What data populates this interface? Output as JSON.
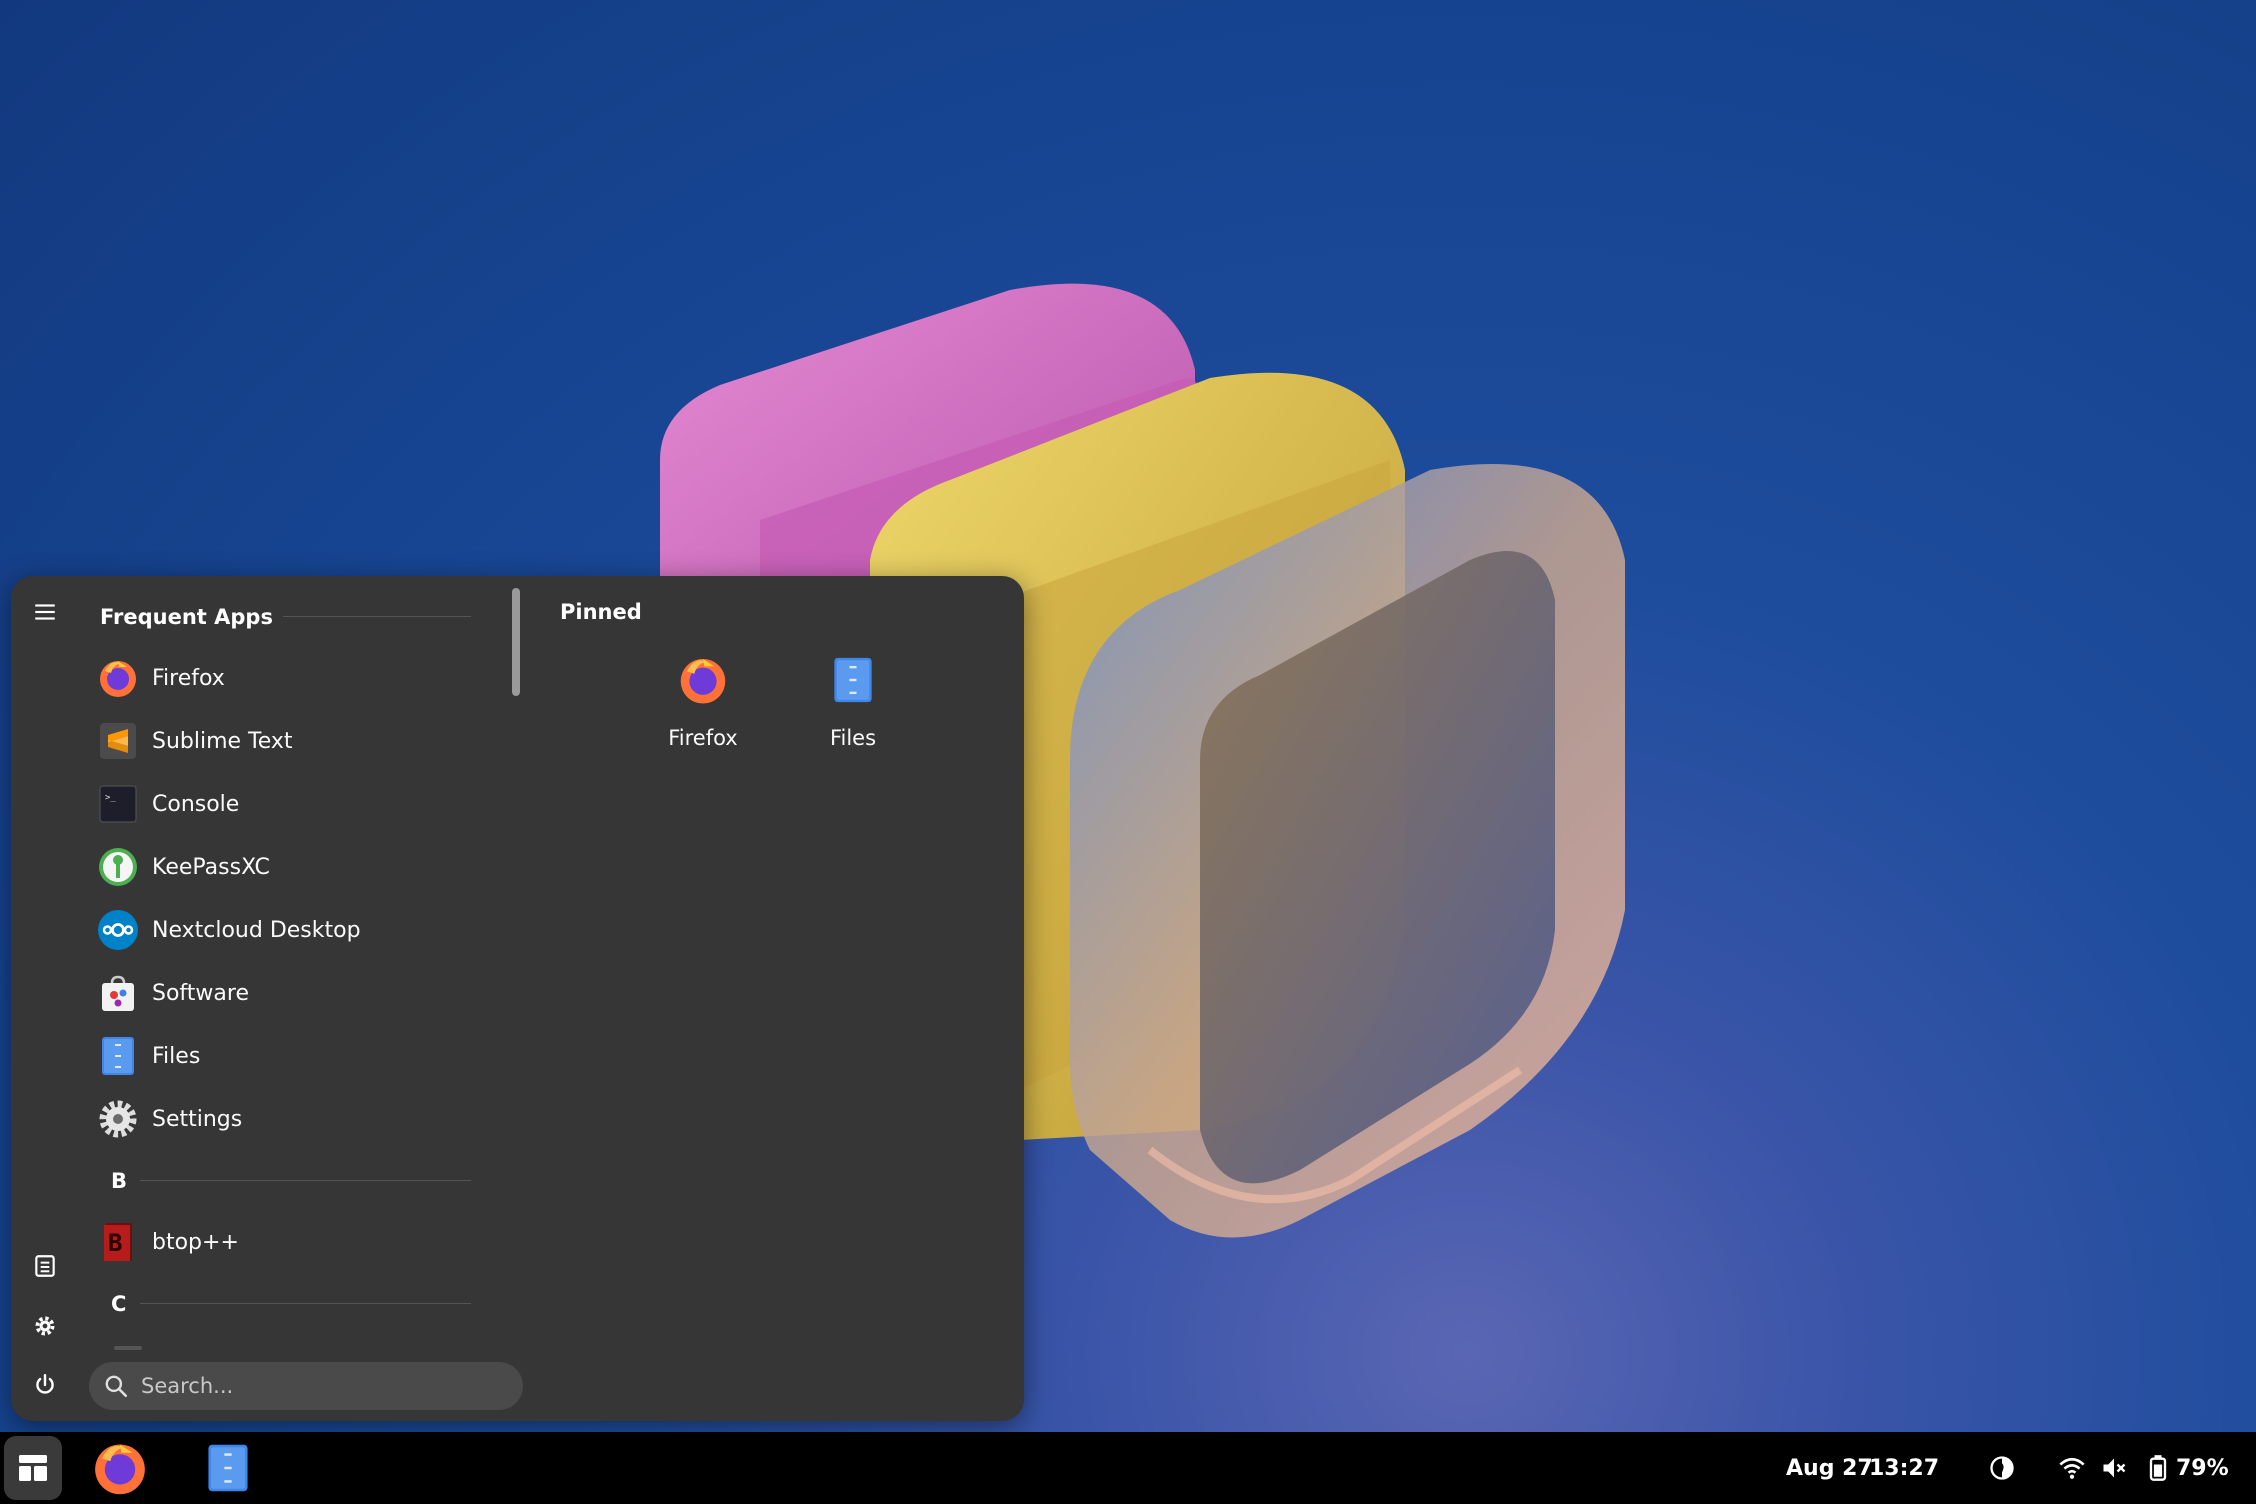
{
  "menu": {
    "frequent_header": "Frequent Apps",
    "frequent_apps": [
      {
        "label": "Firefox",
        "icon": "firefox-icon"
      },
      {
        "label": "Sublime Text",
        "icon": "sublime-text-icon"
      },
      {
        "label": "Console",
        "icon": "console-icon"
      },
      {
        "label": "KeePassXC",
        "icon": "keepassxc-icon"
      },
      {
        "label": "Nextcloud Desktop",
        "icon": "nextcloud-icon"
      },
      {
        "label": "Software",
        "icon": "software-icon"
      },
      {
        "label": "Files",
        "icon": "files-icon"
      },
      {
        "label": "Settings",
        "icon": "settings-icon"
      }
    ],
    "section_b": "B",
    "b_apps": [
      {
        "label": "btop++",
        "icon": "btop-icon"
      }
    ],
    "section_c": "C",
    "pinned_header": "Pinned",
    "pinned": [
      {
        "label": "Firefox",
        "icon": "firefox-icon"
      },
      {
        "label": "Files",
        "icon": "files-icon"
      }
    ],
    "search_placeholder": "Search..."
  },
  "taskbar": {
    "date": "Aug 27",
    "time": "13:27",
    "battery": "79%",
    "apps": [
      "firefox-icon",
      "files-icon"
    ]
  },
  "colors": {
    "menu_bg": "#363636",
    "taskbar_bg": "#000000",
    "desktop_bg": "#1a4795"
  }
}
